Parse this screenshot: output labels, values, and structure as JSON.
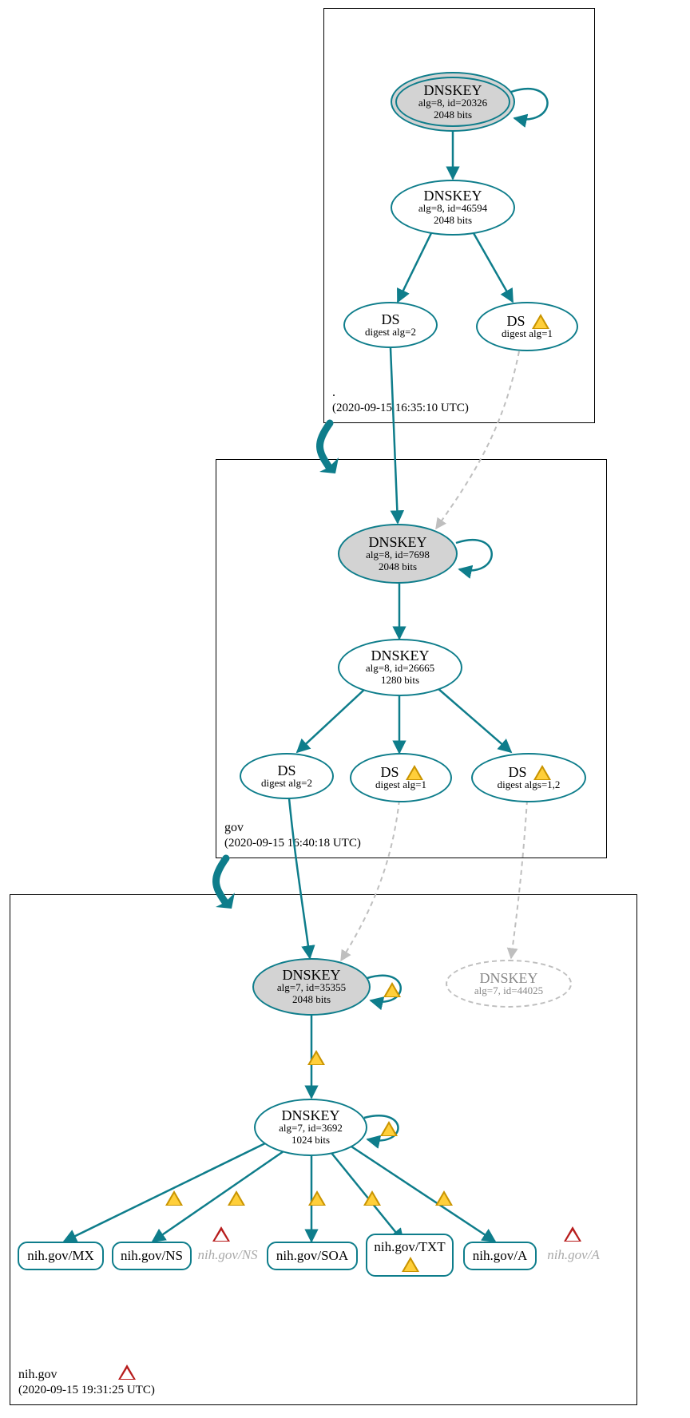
{
  "zones": {
    "root": {
      "name": ".",
      "timestamp": "(2020-09-15 16:35:10 UTC)"
    },
    "gov": {
      "name": "gov",
      "timestamp": "(2020-09-15 16:40:18 UTC)"
    },
    "nihgov": {
      "name": "nih.gov",
      "timestamp": "(2020-09-15 19:31:25 UTC)"
    }
  },
  "nodes": {
    "root_ksk": {
      "title": "DNSKEY",
      "line2": "alg=8, id=20326",
      "line3": "2048 bits"
    },
    "root_zsk": {
      "title": "DNSKEY",
      "line2": "alg=8, id=46594",
      "line3": "2048 bits"
    },
    "root_ds2": {
      "title": "DS",
      "line2": "digest alg=2"
    },
    "root_ds1": {
      "title": "DS",
      "line2": "digest alg=1"
    },
    "gov_ksk": {
      "title": "DNSKEY",
      "line2": "alg=8, id=7698",
      "line3": "2048 bits"
    },
    "gov_zsk": {
      "title": "DNSKEY",
      "line2": "alg=8, id=26665",
      "line3": "1280 bits"
    },
    "gov_ds2": {
      "title": "DS",
      "line2": "digest alg=2"
    },
    "gov_ds1": {
      "title": "DS",
      "line2": "digest alg=1"
    },
    "gov_ds12": {
      "title": "DS",
      "line2": "digest algs=1,2"
    },
    "nih_ksk": {
      "title": "DNSKEY",
      "line2": "alg=7, id=35355",
      "line3": "2048 bits"
    },
    "nih_ghost": {
      "title": "DNSKEY",
      "line2": "alg=7, id=44025"
    },
    "nih_zsk": {
      "title": "DNSKEY",
      "line2": "alg=7, id=3692",
      "line3": "1024 bits"
    }
  },
  "leaves": {
    "mx": {
      "label": "nih.gov/MX"
    },
    "ns": {
      "label": "nih.gov/NS"
    },
    "ns_g": {
      "label": "nih.gov/NS"
    },
    "soa": {
      "label": "nih.gov/SOA"
    },
    "txt": {
      "label": "nih.gov/TXT"
    },
    "a": {
      "label": "nih.gov/A"
    },
    "a_g": {
      "label": "nih.gov/A"
    }
  }
}
